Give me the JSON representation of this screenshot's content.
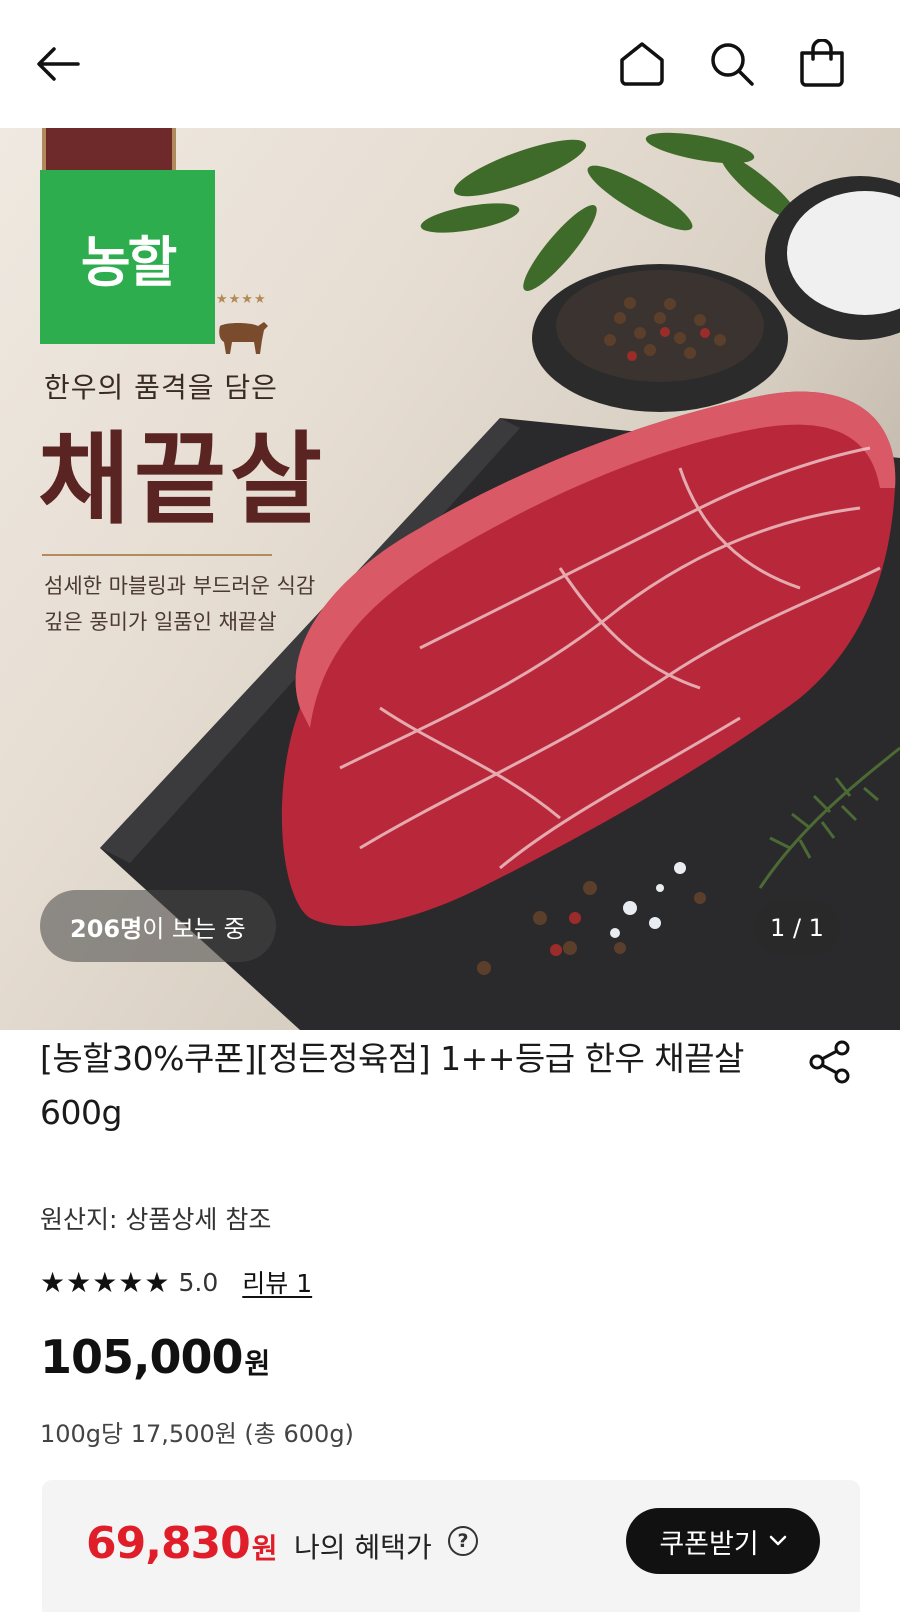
{
  "header": {
    "back_icon": "arrow-left-icon",
    "home_icon": "home-icon",
    "search_icon": "search-icon",
    "cart_icon": "shopping-bag-icon"
  },
  "hero": {
    "brand_badge": "농할",
    "subtitle": "한우의 품격을 담은",
    "title": "채끝살",
    "description_line1": "섬세한 마블링과 부드러운 식감",
    "description_line2": "깊은 풍미가 일품인 채끝살",
    "viewer_count": "206명",
    "viewer_suffix": "이 보는 중",
    "page_indicator": "1 / 1"
  },
  "product": {
    "title": "[농할30%쿠폰][정든정육점] 1++등급 한우 채끝살 600g",
    "origin": "원산지: 상품상세 참조",
    "rating_stars": "★★★★★",
    "rating_value": "5.0",
    "review_link": "리뷰 1",
    "price": "105,000",
    "price_unit": "원",
    "unit_price": "100g당 17,500원 (총 600g)"
  },
  "benefit": {
    "price": "69,830",
    "price_unit": "원",
    "label": "나의 혜택가",
    "help": "?",
    "coupon_button": "쿠폰받기",
    "accent_color": "#e01e2a"
  },
  "colors": {
    "brand_green": "#2ead4e",
    "title_brown": "#5a2423"
  }
}
